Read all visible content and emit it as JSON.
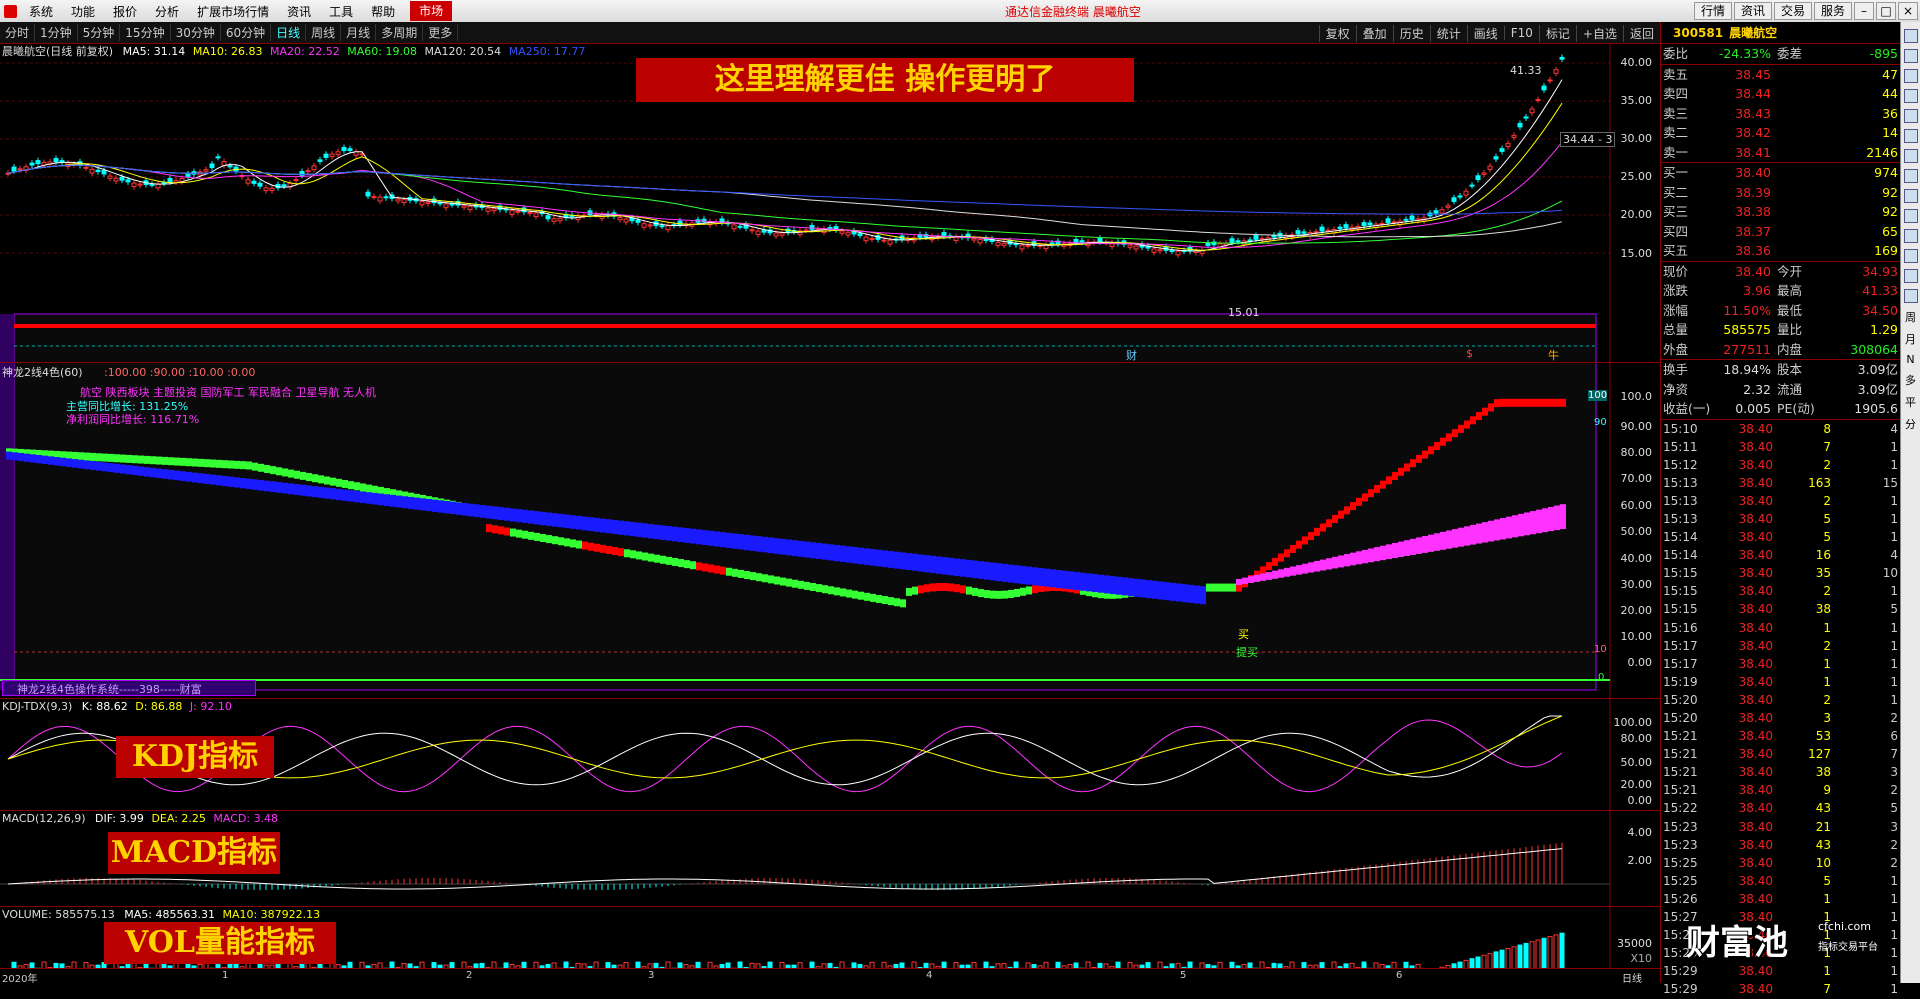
{
  "menu": {
    "items": [
      "系统",
      "功能",
      "报价",
      "分析",
      "扩展市场行情",
      "资讯",
      "工具",
      "帮助"
    ],
    "market": "市场",
    "center": "通达信金融终端  晨曦航空",
    "right_buttons": [
      "行情",
      "资讯",
      "交易",
      "服务"
    ]
  },
  "toolbar": {
    "periods": [
      "分时",
      "1分钟",
      "5分钟",
      "15分钟",
      "30分钟",
      "60分钟",
      "日线",
      "周线",
      "月线",
      "多周期",
      "更多"
    ],
    "active": "日线",
    "actions": [
      "复权",
      "叠加",
      "历史",
      "统计",
      "画线",
      "F10",
      "标记",
      "+自选",
      "返回"
    ]
  },
  "main": {
    "title": "晨曦航空(日线 前复权)",
    "ma": [
      {
        "label": "MA5: 31.14",
        "color": "#ffffff"
      },
      {
        "label": "MA10: 26.83",
        "color": "#ffff00"
      },
      {
        "label": "MA20: 22.52",
        "color": "#ff33ff"
      },
      {
        "label": "MA60: 19.08",
        "color": "#33ff33"
      },
      {
        "label": "MA120: 20.54",
        "color": "#dddddd"
      },
      {
        "label": "MA250: 17.77",
        "color": "#3355ff"
      }
    ],
    "banner": "这里理解更佳    操作更明了",
    "y_ticks": [
      "40.00",
      "35.00",
      "30.00",
      "25.00",
      "20.00",
      "15.00"
    ],
    "high_label": "41.33",
    "low_label": "15.01",
    "last_label": "34.44 - 3",
    "markers": [
      "财",
      "$",
      "牛"
    ]
  },
  "indicator": {
    "title": "神龙2线4色(60)",
    "params": ":100.00  :90.00  :10.00  :0.00",
    "info": [
      "航空 陕西板块 主题投资 国防军工 军民融合 卫星导航 无人机",
      "主营同比增长: 131.25%",
      "净利润同比增长: 116.71%"
    ],
    "footer": "神龙2线4色操作系统-----398-----财富",
    "buy": "买",
    "tip": "提买",
    "y_ticks": [
      "100.0",
      "90.00",
      "80.00",
      "70.00",
      "60.00",
      "50.00",
      "40.00",
      "30.00",
      "20.00",
      "10.00",
      "0.00"
    ],
    "tags": [
      "100",
      "90",
      "10",
      "0"
    ]
  },
  "kdj": {
    "title": "KDJ-TDX(9,3)",
    "k": "K: 88.62",
    "d": "D: 86.88",
    "j": "J: 92.10",
    "banner": "KDJ指标",
    "y_ticks": [
      "100.00",
      "80.00",
      "50.00",
      "20.00",
      "0.00"
    ]
  },
  "macd": {
    "title": "MACD(12,26,9)",
    "dif": "DIF: 3.99",
    "dea": "DEA: 2.25",
    "macd": "MACD: 3.48",
    "banner": "MACD指标",
    "y_ticks": [
      "4.00",
      "2.00"
    ]
  },
  "vol": {
    "title": "VOLUME: 585575.13",
    "ma5": "MA5: 485563.31",
    "ma10": "MA10: 387922.13",
    "banner": "VOL量能指标",
    "y_ticks": [
      "35000",
      "X10"
    ]
  },
  "x_axis": [
    "2020年",
    "1",
    "2",
    "3",
    "4",
    "5",
    "6"
  ],
  "x_axis_right": "日线",
  "quote": {
    "code": "300581",
    "name": "晨曦航空",
    "wb": {
      "k1": "委比",
      "v1": "-24.33%",
      "k2": "委差",
      "v2": "-895"
    },
    "asks": [
      {
        "label": "卖五",
        "price": "38.45",
        "vol": "47"
      },
      {
        "label": "卖四",
        "price": "38.44",
        "vol": "44"
      },
      {
        "label": "卖三",
        "price": "38.43",
        "vol": "36"
      },
      {
        "label": "卖二",
        "price": "38.42",
        "vol": "14"
      },
      {
        "label": "卖一",
        "price": "38.41",
        "vol": "2146"
      }
    ],
    "bids": [
      {
        "label": "买一",
        "price": "38.40",
        "vol": "974"
      },
      {
        "label": "买二",
        "price": "38.39",
        "vol": "92"
      },
      {
        "label": "买三",
        "price": "38.38",
        "vol": "92"
      },
      {
        "label": "买四",
        "price": "38.37",
        "vol": "65"
      },
      {
        "label": "买五",
        "price": "38.36",
        "vol": "169"
      }
    ],
    "stats": [
      {
        "k1": "现价",
        "v1": "38.40",
        "c1": "red",
        "k2": "今开",
        "v2": "34.93",
        "c2": "red"
      },
      {
        "k1": "涨跌",
        "v1": "3.96",
        "c1": "red",
        "k2": "最高",
        "v2": "41.33",
        "c2": "red"
      },
      {
        "k1": "涨幅",
        "v1": "11.50%",
        "c1": "red",
        "k2": "最低",
        "v2": "34.50",
        "c2": "red"
      },
      {
        "k1": "总量",
        "v1": "585575",
        "c1": "yellow",
        "k2": "量比",
        "v2": "1.29",
        "c2": "yellow"
      },
      {
        "k1": "外盘",
        "v1": "277511",
        "c1": "red",
        "k2": "内盘",
        "v2": "308064",
        "c2": "green"
      }
    ],
    "stats2": [
      {
        "k1": "换手",
        "v1": "18.94%",
        "k2": "股本",
        "v2": "3.09亿"
      },
      {
        "k1": "净资",
        "v1": "2.32",
        "k2": "流通",
        "v2": "3.09亿"
      },
      {
        "k1": "收益(一)",
        "v1": "0.005",
        "k2": "PE(动)",
        "v2": "1905.6"
      }
    ],
    "ticks": [
      [
        "15:10",
        "38.40",
        "8",
        "4"
      ],
      [
        "15:11",
        "38.40",
        "7",
        "1"
      ],
      [
        "15:12",
        "38.40",
        "2",
        "1"
      ],
      [
        "15:13",
        "38.40",
        "163",
        "15"
      ],
      [
        "15:13",
        "38.40",
        "2",
        "1"
      ],
      [
        "15:13",
        "38.40",
        "5",
        "1"
      ],
      [
        "15:14",
        "38.40",
        "5",
        "1"
      ],
      [
        "15:14",
        "38.40",
        "16",
        "4"
      ],
      [
        "15:15",
        "38.40",
        "35",
        "10"
      ],
      [
        "15:15",
        "38.40",
        "2",
        "1"
      ],
      [
        "15:15",
        "38.40",
        "38",
        "5"
      ],
      [
        "15:16",
        "38.40",
        "1",
        "1"
      ],
      [
        "15:17",
        "38.40",
        "2",
        "1"
      ],
      [
        "15:17",
        "38.40",
        "1",
        "1"
      ],
      [
        "15:19",
        "38.40",
        "1",
        "1"
      ],
      [
        "15:20",
        "38.40",
        "2",
        "1"
      ],
      [
        "15:20",
        "38.40",
        "3",
        "2"
      ],
      [
        "15:21",
        "38.40",
        "53",
        "6"
      ],
      [
        "15:21",
        "38.40",
        "127",
        "7"
      ],
      [
        "15:21",
        "38.40",
        "38",
        "3"
      ],
      [
        "15:21",
        "38.40",
        "9",
        "2"
      ],
      [
        "15:22",
        "38.40",
        "43",
        "5"
      ],
      [
        "15:23",
        "38.40",
        "21",
        "3"
      ],
      [
        "15:23",
        "38.40",
        "43",
        "2"
      ],
      [
        "15:25",
        "38.40",
        "10",
        "2"
      ],
      [
        "15:25",
        "38.40",
        "5",
        "1"
      ],
      [
        "15:26",
        "38.40",
        "1",
        "1"
      ],
      [
        "15:27",
        "38.40",
        "1",
        "1"
      ],
      [
        "15:28",
        "38.40",
        "1",
        "1"
      ],
      [
        "15:29",
        "38.40",
        "1",
        "1"
      ],
      [
        "15:29",
        "38.40",
        "1",
        "1"
      ],
      [
        "15:29",
        "38.40",
        "7",
        "1"
      ]
    ]
  },
  "watermark": {
    "big": "财富池",
    "site": "cfchi.com",
    "sub": "指标交易平台"
  },
  "sidebar": [
    "周",
    "月",
    "N",
    "多",
    "平",
    "分"
  ],
  "colors": {
    "up": "#ff3333",
    "down": "#00ffff",
    "border": "#880000"
  }
}
